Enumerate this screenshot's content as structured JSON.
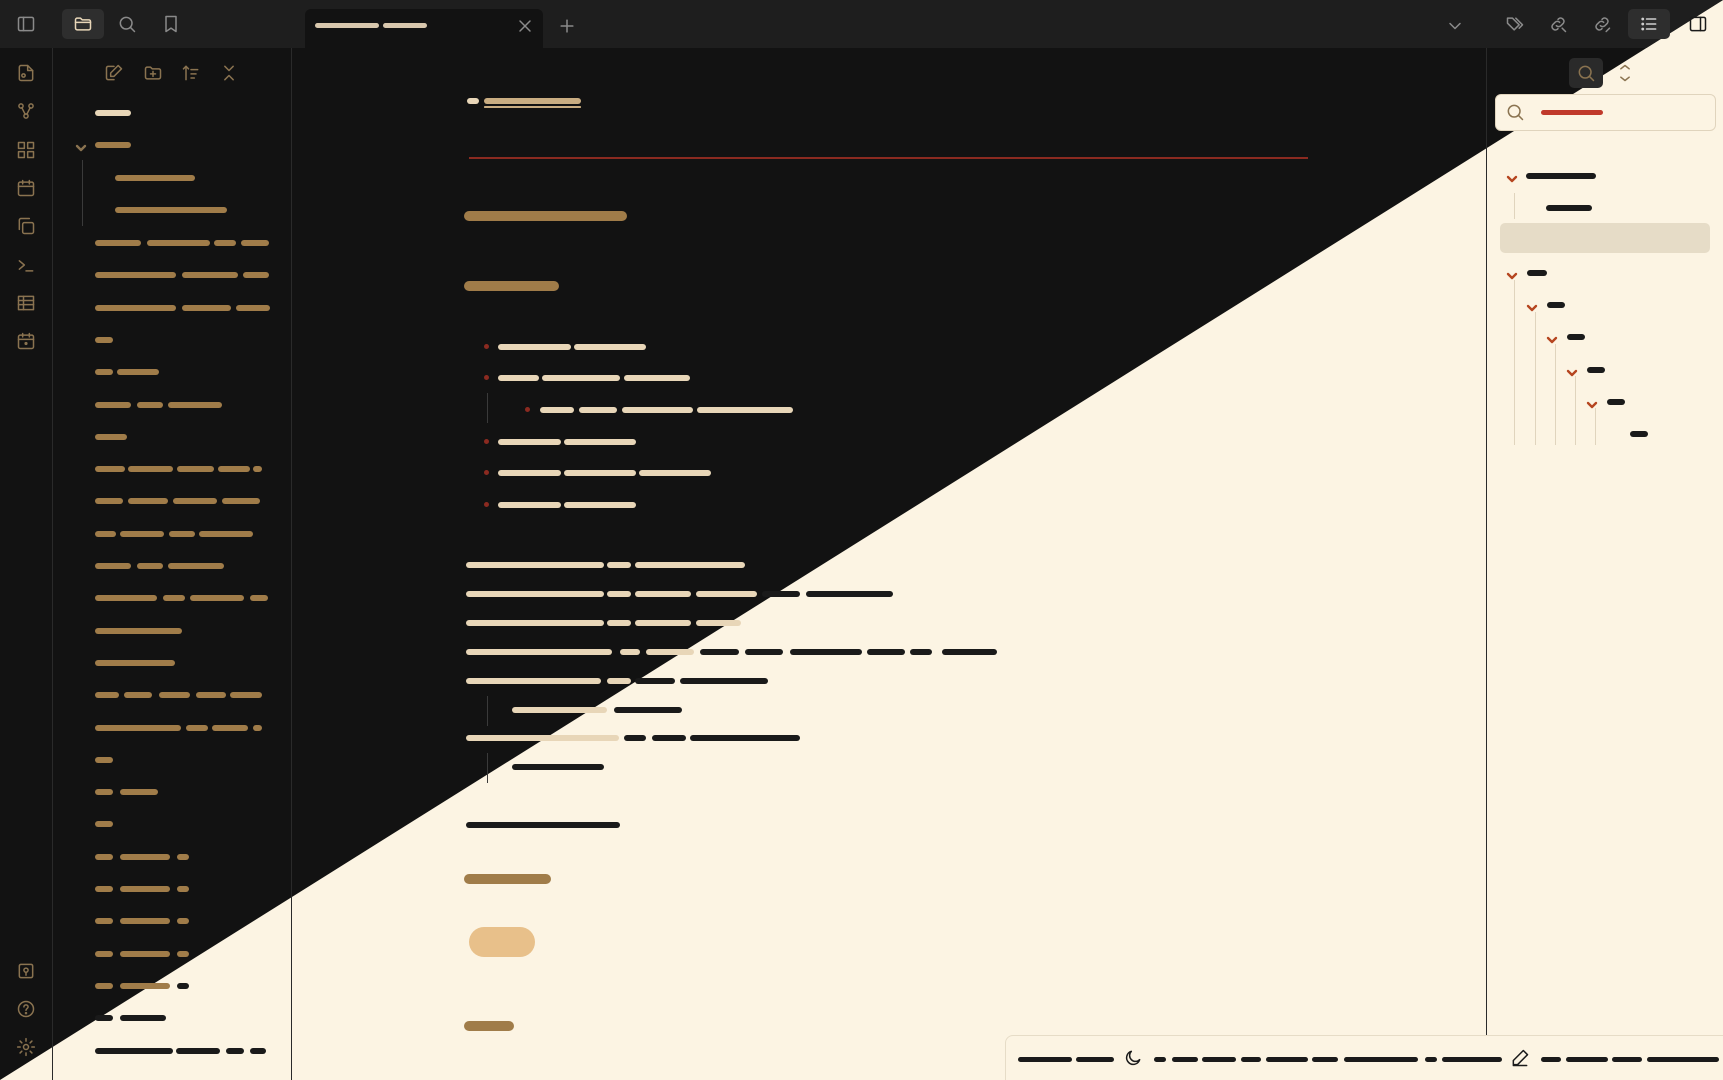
{
  "theme": {
    "dark_bg": "#121212",
    "dark_panel": "#161616",
    "dark_titlebar": "#1e1e1e",
    "light_bg": "#fcf4e3",
    "accent_tan": "#d9b98d",
    "text_gold": "#a07c49",
    "text_dark": "#1a1a1a",
    "accent_red": "#c0392b",
    "highlight_pill": "#e8c08a",
    "divider_diagonal": true
  },
  "icons": {
    "ribbon": [
      "sidebar-toggle-icon",
      "folder-icon",
      "search-icon",
      "bookmark-icon"
    ],
    "rail": [
      "new-note-icon",
      "graph-icon",
      "blocks-icon",
      "calendar-icon",
      "copy-icon",
      "terminal-icon",
      "table-icon",
      "daily-note-icon"
    ],
    "rail_bottom": [
      "vault-icon",
      "help-icon",
      "settings-icon"
    ],
    "explorer_toolbar": [
      "new-note-icon",
      "new-folder-icon",
      "sort-icon",
      "collapse-all-icon"
    ],
    "right_toolbar": [
      "chevron-down-icon",
      "tags-icon",
      "link-out-icon",
      "link-in-icon",
      "outline-icon",
      "reading-mode-icon"
    ],
    "outline_toolbar": [
      "search-icon",
      "collapse-icon"
    ],
    "status": [
      "moon-icon",
      "pencil-icon"
    ]
  },
  "tab": {
    "active": true,
    "close_icon": "close-icon",
    "new_tab_icon": "plus-icon"
  },
  "outline_caret_icon": "chevron-down-icon",
  "note": {
    "task_checkbox": "checkbox-icon"
  }
}
